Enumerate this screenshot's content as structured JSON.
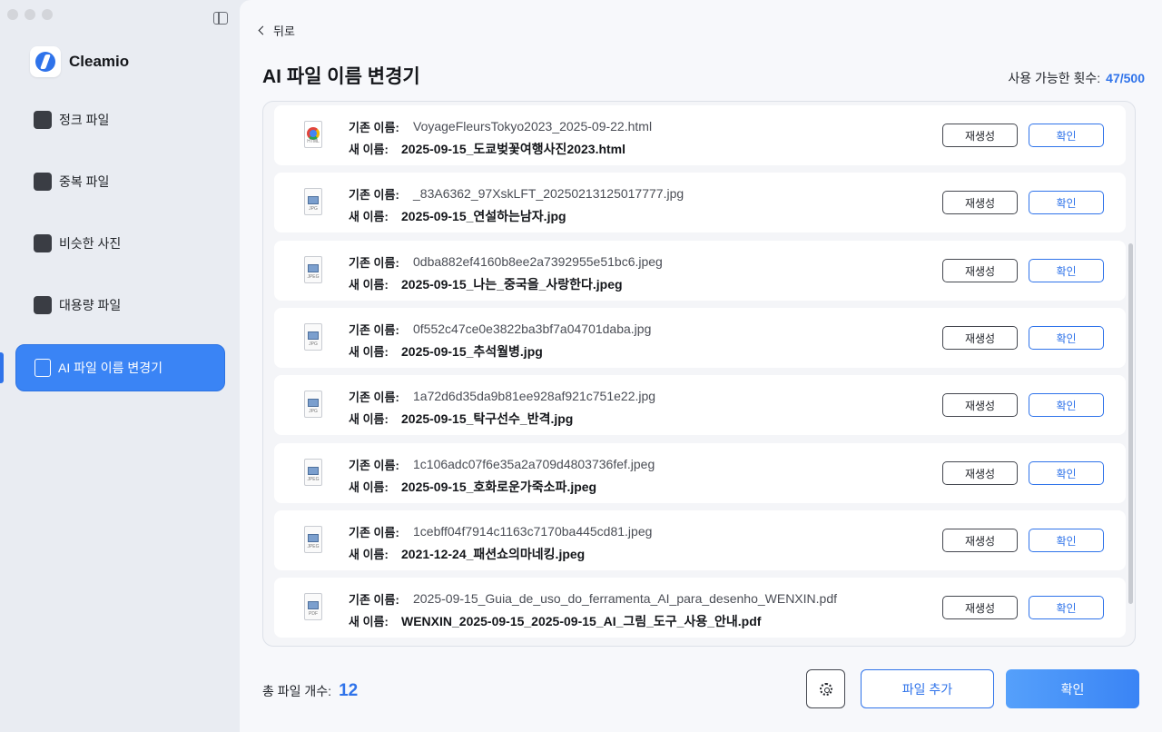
{
  "sidebar": {
    "brand": "Cleamio",
    "items": [
      {
        "label": "정크 파일",
        "icon": "broom-icon"
      },
      {
        "label": "중복 파일",
        "icon": "folder-icon"
      },
      {
        "label": "비슷한 사진",
        "icon": "photo-icon"
      },
      {
        "label": "대용량 파일",
        "icon": "storage-icon"
      },
      {
        "label": "AI 파일 이름 변경기",
        "icon": "file-edit-icon",
        "active": true
      }
    ]
  },
  "header": {
    "back_label": "뒤로",
    "title": "AI 파일 이름 변경기",
    "quota_label": "사용 가능한 횟수:",
    "quota_value": "47/500"
  },
  "labels": {
    "old_name": "기존 이름:",
    "new_name": "새 이름:",
    "regenerate": "재생성",
    "confirm": "확인"
  },
  "files": [
    {
      "type": "html",
      "ext": "HTML",
      "old": "VoyageFleursTokyo2023_2025-09-22.html",
      "new": "2025-09-15_도쿄벚꽃여행사진2023.html"
    },
    {
      "type": "jpg",
      "ext": "JPG",
      "old": "_83A6362_97XskLFT_20250213125017777.jpg",
      "new": "2025-09-15_연설하는남자.jpg"
    },
    {
      "type": "jpeg",
      "ext": "JPEG",
      "old": "0dba882ef4160b8ee2a7392955e51bc6.jpeg",
      "new": "2025-09-15_나는_중국을_사랑한다.jpeg"
    },
    {
      "type": "jpg",
      "ext": "JPG",
      "old": "0f552c47ce0e3822ba3bf7a04701daba.jpg",
      "new": "2025-09-15_추석월병.jpg"
    },
    {
      "type": "jpg",
      "ext": "JPG",
      "old": "1a72d6d35da9b81ee928af921c751e22.jpg",
      "new": "2025-09-15_탁구선수_반격.jpg"
    },
    {
      "type": "jpeg",
      "ext": "JPEG",
      "old": "1c106adc07f6e35a2a709d4803736fef.jpeg",
      "new": "2025-09-15_호화로운가죽소파.jpeg"
    },
    {
      "type": "jpeg",
      "ext": "JPEG",
      "old": "1cebff04f7914c1163c7170ba445cd81.jpeg",
      "new": "2021-12-24_패션쇼의마네킹.jpeg"
    },
    {
      "type": "pdf",
      "ext": "PDF",
      "old": "2025-09-15_Guia_de_uso_do_ferramenta_AI_para_desenho_WENXIN.pdf",
      "new": "WENXIN_2025-09-15_2025-09-15_AI_그림_도구_사용_안내.pdf"
    }
  ],
  "footer": {
    "total_label": "총 파일 개수:",
    "total_count": "12",
    "add_label": "파일 추가",
    "confirm_label": "확인"
  },
  "colors": {
    "accent": "#2f73ea",
    "sidebar_bg": "#e9ecf2",
    "active_item_bg": "#3a84f5"
  }
}
